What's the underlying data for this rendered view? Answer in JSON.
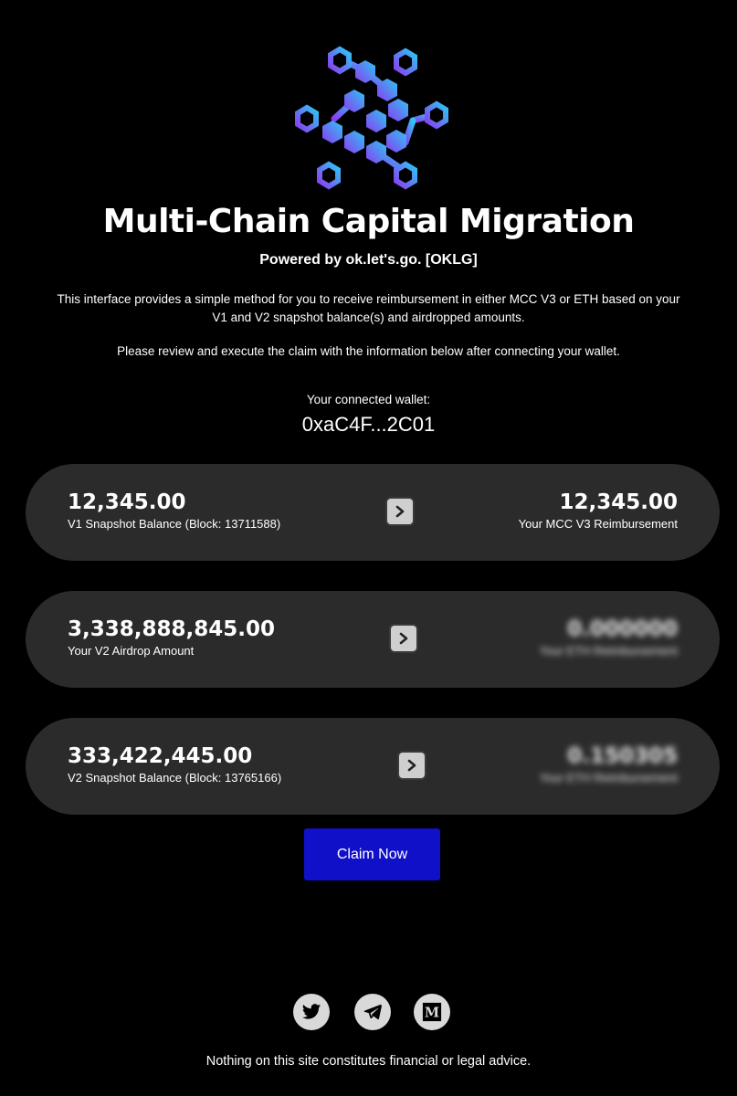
{
  "header": {
    "title": "Multi-Chain Capital Migration",
    "subtitle": "Powered by ok.let's.go. [OKLG]",
    "intro": "This interface provides a simple method for you to receive reimbursement in either MCC V3 or ETH based on your V1 and V2 snapshot balance(s) and airdropped amounts.",
    "instruction": "Please review and execute the claim with the information below after connecting your wallet."
  },
  "wallet": {
    "label": "Your connected wallet:",
    "address": "0xaC4F...2C01"
  },
  "cards": [
    {
      "left_amount": "12,345.00",
      "left_label": "V1 Snapshot Balance (Block: 13711588)",
      "right_amount": "12,345.00",
      "right_label": "Your MCC V3 Reimbursement",
      "right_obscured": false
    },
    {
      "left_amount": "3,338,888,845.00",
      "left_label": "Your V2 Airdrop Amount",
      "right_amount": "0.000000",
      "right_label": "Your ETH Reimbursement",
      "right_obscured": true
    },
    {
      "left_amount": "333,422,445.00",
      "left_label": "V2 Snapshot Balance (Block: 13765166)",
      "right_amount": "0.150305",
      "right_label": "Your ETH Reimbursement",
      "right_obscured": true
    }
  ],
  "actions": {
    "claim_label": "Claim Now"
  },
  "footer": {
    "social_icons": [
      "twitter-icon",
      "telegram-icon",
      "medium-icon"
    ],
    "disclaimer": "Nothing on this site constitutes financial or legal advice."
  },
  "colors": {
    "background": "#000000",
    "card": "#2b2b2b",
    "button": "#1010c8",
    "logo_gradient_start": "#2ec5f5",
    "logo_gradient_end": "#8a3df0"
  }
}
